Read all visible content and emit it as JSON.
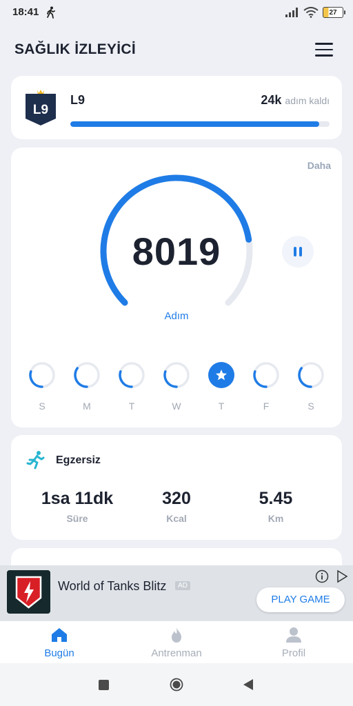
{
  "status_bar": {
    "time": "18:41",
    "battery": "27"
  },
  "header": {
    "title": "SAĞLIK İZLEYİCİ",
    "menu_icon": "hamburger-icon"
  },
  "level": {
    "badge": "L9",
    "label": "L9",
    "remaining_value": "24k",
    "remaining_text": "adım kaldı",
    "progress": 0.96
  },
  "steps": {
    "more_label": "Daha",
    "count": "8019",
    "unit": "Adım",
    "goal_progress": 0.8,
    "pause_icon": "pause-icon"
  },
  "week": [
    {
      "label": "S",
      "progress": 0.3,
      "active": false
    },
    {
      "label": "M",
      "progress": 0.35,
      "active": false
    },
    {
      "label": "T",
      "progress": 0.3,
      "active": false
    },
    {
      "label": "W",
      "progress": 0.3,
      "active": false
    },
    {
      "label": "T",
      "progress": 1,
      "active": true
    },
    {
      "label": "F",
      "progress": 0.3,
      "active": false
    },
    {
      "label": "S",
      "progress": 0.35,
      "active": false
    }
  ],
  "exercise": {
    "title": "Egzersiz",
    "stats": [
      {
        "value": "1sa 11dk",
        "label": "Süre"
      },
      {
        "value": "320",
        "label": "Kcal"
      },
      {
        "value": "5.45",
        "label": "Km"
      }
    ]
  },
  "ad": {
    "title": "World of Tanks Blitz",
    "tag": "AD",
    "button": "PLAY GAME"
  },
  "bottom_nav": [
    {
      "label": "Bugün",
      "icon": "home-icon",
      "active": true
    },
    {
      "label": "Antrenman",
      "icon": "flame-icon",
      "active": false
    },
    {
      "label": "Profil",
      "icon": "person-icon",
      "active": false
    }
  ],
  "colors": {
    "accent": "#1f7ce6",
    "track": "#e6e9ef",
    "background": "#eef0f5"
  }
}
